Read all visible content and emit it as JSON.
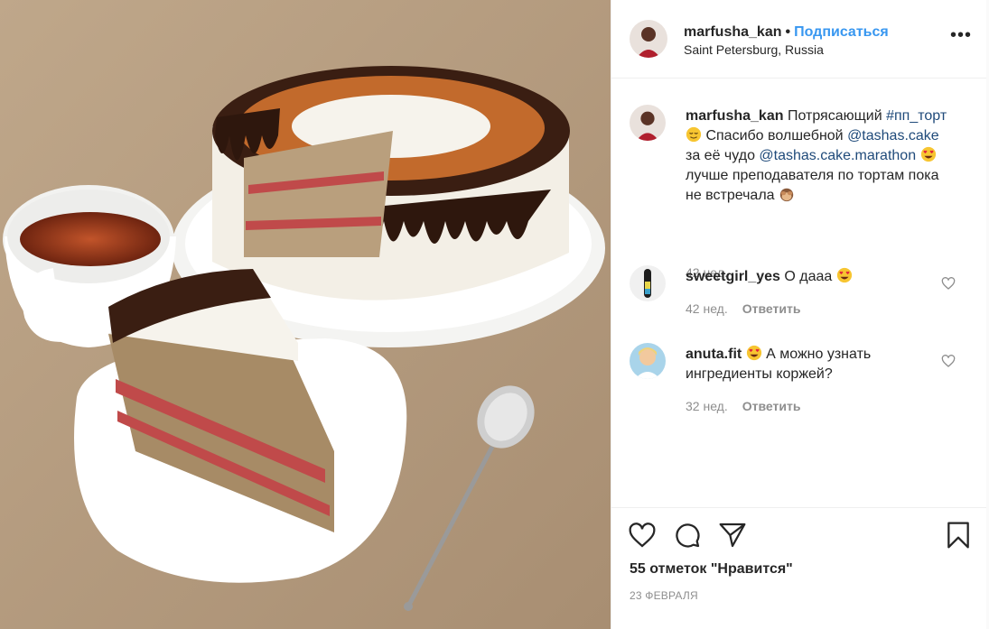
{
  "post": {
    "username": "marfusha_kan",
    "separator": "•",
    "follow_label": "Подписаться",
    "location": "Saint Petersburg, Russia",
    "more_label": "•••"
  },
  "caption": {
    "username": "marfusha_kan",
    "text_1": "Потрясающий",
    "hashtag": "#пп_торт",
    "text_2": "Спасибо волшебной",
    "mention_1": "@tashas.cake",
    "text_3": "за её чудо",
    "mention_2": "@tashas.cake.marathon",
    "text_4": "лучше преподавателя по тортам пока не встречала",
    "time": "42 нед."
  },
  "comments": [
    {
      "username": "sweetgirl_yes",
      "text": "О дааа",
      "time": "42 нед.",
      "reply_label": "Ответить"
    },
    {
      "username": "anuta.fit",
      "text": "А можно узнать ингредиенты коржей?",
      "time": "32 нед.",
      "reply_label": "Ответить"
    }
  ],
  "footer": {
    "likes": "55 отметок \"Нравится\"",
    "date": "23 ФЕВРАЛЯ"
  },
  "icons": {
    "like": "heart-icon",
    "comment": "comment-icon",
    "share": "share-icon",
    "save": "bookmark-icon"
  },
  "colors": {
    "link_blue": "#3897f0",
    "muted": "#8e8e8e",
    "text": "#262626"
  }
}
